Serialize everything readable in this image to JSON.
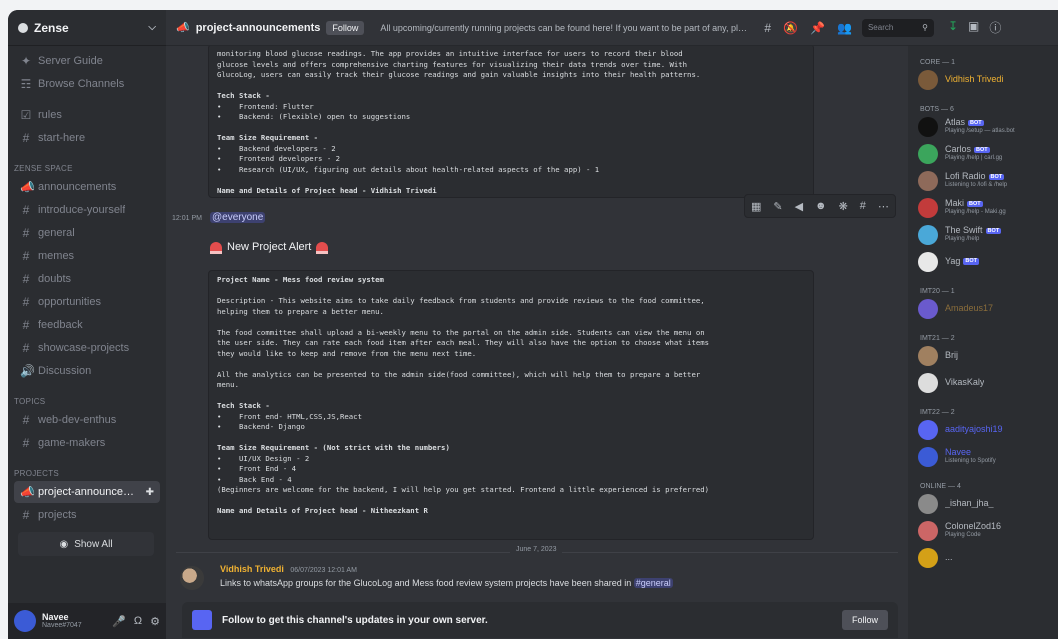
{
  "server": {
    "name": "Zense"
  },
  "channels": [
    {
      "icon": "server-guide",
      "label": "Server Guide"
    },
    {
      "icon": "browse",
      "label": "Browse Channels"
    },
    {
      "cat": "",
      "icon": "rules",
      "label": "rules"
    },
    {
      "icon": "hash",
      "label": "start-here"
    }
  ],
  "categories": {
    "zense_space": "ZENSE SPACE",
    "topics": "TOPICS",
    "projects": "PROJECTS"
  },
  "zense_space_channels": [
    "announcements",
    "introduce-yourself",
    "general",
    "memes",
    "doubts",
    "opportunities",
    "feedback",
    "showcase-projects",
    "Discussion"
  ],
  "topic_channels": [
    "web-dev-enthus",
    "game-makers"
  ],
  "project_channels": [
    "project-announceme...",
    "projects"
  ],
  "show_all": "Show All",
  "user": {
    "name": "Navee",
    "tag": "Navee#7047"
  },
  "header": {
    "channel": "project-announcements",
    "follow": "Follow",
    "topic": "All upcoming/currently running projects can be found here! If you want to be part of any, please co...",
    "search_placeholder": "Search"
  },
  "codeblock1": [
    "monitoring blood glucose readings. The app provides an intuitive interface for users to record their blood",
    "glucose levels and offers comprehensive charting features for visualizing their data trends over time. With",
    "GlucoLog, users can easily track their glucose readings and gain valuable insights into their health patterns.",
    "",
    "Tech Stack -",
    "•    Frontend: Flutter",
    "•    Backend: (Flexible) open to suggestions",
    "",
    "Team Size Requirement -",
    "•    Backend developers - 2",
    "•    Frontend developers - 2",
    "•    Research (UI/UX, figuring out details about health-related aspects of the app) - 1",
    "",
    "Name and Details of Project head - Vidhish Trivedi"
  ],
  "message_time": "12:01 PM",
  "mention": "@everyone",
  "alert_text": "New Project Alert",
  "codeblock2": [
    "Project Name - Mess food review system",
    "",
    "Description - This website aims to take daily feedback from students and provide reviews to the food committee,",
    "helping them to prepare a better menu.",
    "",
    "The food committee shall upload a bi-weekly menu to the portal on the admin side. Students can view the menu on",
    "the user side. They can rate each food item after each meal. They will also have the option to choose what items",
    "they would like to keep and remove from the menu next time.",
    "",
    "All the analytics can be presented to the admin side(food committee), which will help them to prepare a better",
    "menu.",
    "",
    "Tech Stack -",
    "•    Front end- HTML,CSS,JS,React",
    "•    Backend- Django",
    "",
    "Team Size Requirement - (Not strict with the numbers)",
    "•    UI/UX Design - 2",
    "•    Front End - 4",
    "•    Back End - 4",
    "(Beginners are welcome for the backend, I will help you get started. Frontend a little experienced is preferred)",
    "",
    "Name and Details of Project head - Nitheezkant R"
  ],
  "date_divider": "June 7, 2023",
  "message2": {
    "author": "Vidhish Trivedi",
    "time": "06/07/2023 12:01 AM",
    "text_before": "Links to whatsApp groups for the GlucoLog and Mess food review system projects have been shared in ",
    "channel": "#general"
  },
  "follow_bar": {
    "text": "Follow to get this channel's updates in your own server.",
    "button": "Follow"
  },
  "members": [
    {
      "cat": "CORE — 1"
    },
    {
      "name": "Vidhish Trivedi",
      "color": "#f0b232",
      "avatar": "#7a5a3a"
    },
    {
      "cat": "BOTS — 6"
    },
    {
      "name": "Atlas",
      "bot": "BOT",
      "status": "Playing /setup — atlas.bot",
      "color": "#b5bac1",
      "avatar": "#111111"
    },
    {
      "name": "Carlos",
      "bot": "BOT",
      "status": "Playing /help | carl.gg",
      "color": "#b5bac1",
      "avatar": "#3ba55c"
    },
    {
      "name": "Lofi Radio",
      "bot": "BOT",
      "status": "Listening to /lofi & /help",
      "color": "#b5bac1",
      "avatar": "#8e6a5a"
    },
    {
      "name": "Maki",
      "bot": "BOT",
      "status": "Playing /help - Maki.gg",
      "color": "#b5bac1",
      "avatar": "#c23b3b"
    },
    {
      "name": "The Swift",
      "bot": "BOT",
      "status": "Playing /help",
      "color": "#b5bac1",
      "avatar": "#4aa8d8"
    },
    {
      "name": "Yag",
      "bot": "BOT",
      "status": "",
      "color": "#b5bac1",
      "avatar": "#e8e8e8"
    },
    {
      "cat": "IMT20 — 1"
    },
    {
      "name": "Amadeus17",
      "color": "#8a6d3b",
      "avatar": "#6a5acd"
    },
    {
      "cat": "IMT21 — 2"
    },
    {
      "name": "Brij",
      "color": "#b5bac1",
      "avatar": "#a08060"
    },
    {
      "name": "VikasKaly",
      "color": "#b5bac1",
      "avatar": "#dddddd"
    },
    {
      "cat": "IMT22 — 2"
    },
    {
      "name": "aadityajoshi19",
      "color": "#5865f2",
      "avatar": "#5865f2"
    },
    {
      "name": "Navee",
      "status": "Listening to Spotify",
      "color": "#5865f2",
      "avatar": "#3b5bd6"
    },
    {
      "cat": "ONLINE — 4"
    },
    {
      "name": "_ishan_jha_",
      "color": "#b5bac1",
      "avatar": "#8a8a8a"
    },
    {
      "name": "ColonelZod16",
      "status": "Playing Code",
      "color": "#b5bac1",
      "avatar": "#c66"
    },
    {
      "name": "...",
      "color": "#b5bac1",
      "avatar": "#d4a017"
    }
  ]
}
